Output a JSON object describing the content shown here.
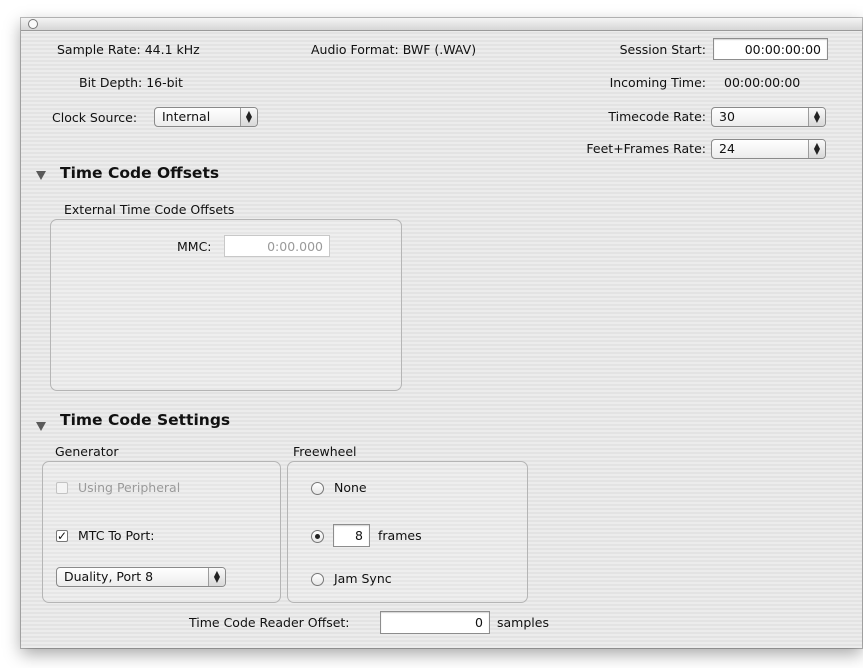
{
  "info": {
    "sample_rate_label": "Sample Rate:",
    "sample_rate_value": "44.1 kHz",
    "audio_format_label": "Audio Format:",
    "audio_format_value": "BWF (.WAV)",
    "bit_depth_label": "Bit Depth:",
    "bit_depth_value": "16-bit",
    "clock_source_label": "Clock Source:",
    "clock_source_value": "Internal"
  },
  "session": {
    "session_start_label": "Session Start:",
    "session_start_value": "00:00:00:00",
    "incoming_time_label": "Incoming Time:",
    "incoming_time_value": "00:00:00:00",
    "timecode_rate_label": "Timecode Rate:",
    "timecode_rate_value": "30",
    "feet_frames_rate_label": "Feet+Frames Rate:",
    "feet_frames_rate_value": "24"
  },
  "offsets": {
    "heading": "Time Code Offsets",
    "group_label": "External Time Code Offsets",
    "mmc_label": "MMC:",
    "mmc_value": "0:00.000"
  },
  "settings": {
    "heading": "Time Code Settings",
    "generator": {
      "label": "Generator",
      "using_peripheral_label": "Using Peripheral",
      "using_peripheral_checked": false,
      "mtc_to_port_label": "MTC To Port:",
      "mtc_to_port_checked": true,
      "port_value": "Duality, Port 8"
    },
    "freewheel": {
      "label": "Freewheel",
      "none_label": "None",
      "frames_value": "8",
      "frames_label": "frames",
      "jam_sync_label": "Jam Sync",
      "selected": "frames"
    },
    "reader_offset_label": "Time Code Reader Offset:",
    "reader_offset_value": "0",
    "reader_offset_unit": "samples"
  },
  "glyphs": {
    "checkmark": "✓",
    "arrow_up": "▲",
    "arrow_down": "▼"
  }
}
